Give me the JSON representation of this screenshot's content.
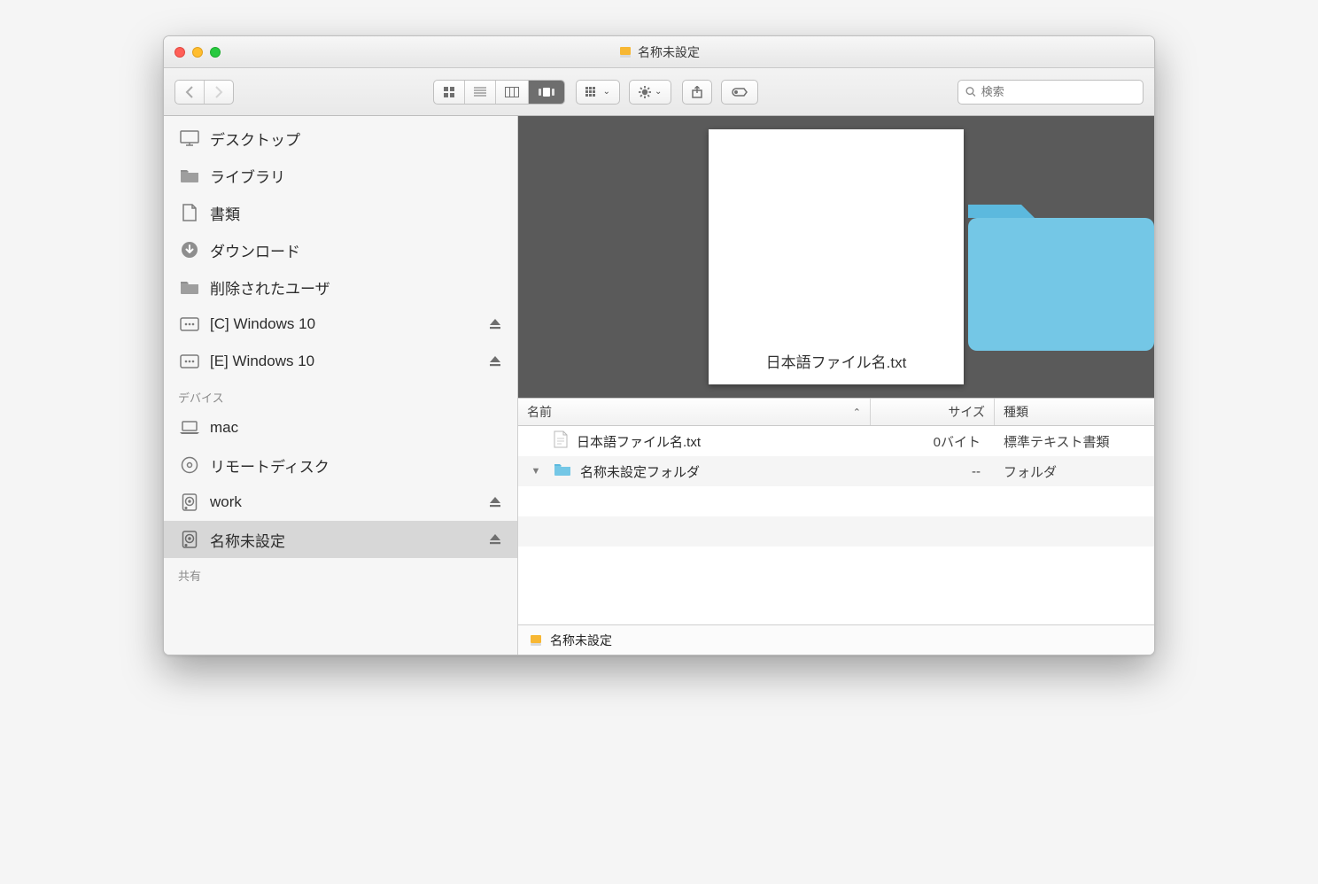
{
  "window": {
    "title": "名称未設定"
  },
  "toolbar": {
    "search_placeholder": "検索"
  },
  "sidebar": {
    "favorites": [
      {
        "icon": "desktop",
        "label": "デスクトップ"
      },
      {
        "icon": "folder",
        "label": "ライブラリ"
      },
      {
        "icon": "doc",
        "label": "書類"
      },
      {
        "icon": "download",
        "label": "ダウンロード"
      },
      {
        "icon": "folder",
        "label": "削除されたユーザ"
      },
      {
        "icon": "bootcamp",
        "label": "[C] Windows 10",
        "ejectable": true
      },
      {
        "icon": "bootcamp",
        "label": "[E] Windows 10",
        "ejectable": true
      }
    ],
    "section_devices": "デバイス",
    "devices": [
      {
        "icon": "laptop",
        "label": "mac"
      },
      {
        "icon": "optical",
        "label": "リモートディスク"
      },
      {
        "icon": "hdd",
        "label": "work",
        "ejectable": true
      },
      {
        "icon": "hdd",
        "label": "名称未設定",
        "ejectable": true,
        "selected": true
      }
    ],
    "section_shared": "共有"
  },
  "preview": {
    "file_name": "日本語ファイル名.txt"
  },
  "columns": {
    "name": "名前",
    "size": "サイズ",
    "kind": "種類"
  },
  "rows": [
    {
      "type": "file",
      "name": "日本語ファイル名.txt",
      "size": "0バイト",
      "kind": "標準テキスト書類"
    },
    {
      "type": "folder",
      "name": "名称未設定フォルダ",
      "size": "--",
      "kind": "フォルダ",
      "expandable": true
    }
  ],
  "pathbar": {
    "location": "名称未設定"
  }
}
